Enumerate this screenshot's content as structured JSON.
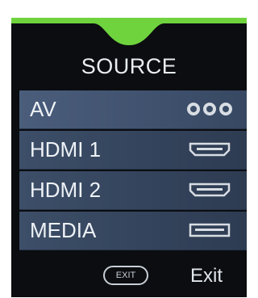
{
  "menu": {
    "title": "SOURCE",
    "accent_color": "#6fd33d",
    "items": [
      {
        "label": "AV",
        "icon": "av-composite-icon",
        "selected": true
      },
      {
        "label": "HDMI 1",
        "icon": "hdmi-port-icon",
        "selected": false
      },
      {
        "label": "HDMI 2",
        "icon": "hdmi-port-icon",
        "selected": false
      },
      {
        "label": "MEDIA",
        "icon": "usb-port-icon",
        "selected": false
      }
    ]
  },
  "footer": {
    "key_label": "EXIT",
    "action_label": "Exit"
  }
}
